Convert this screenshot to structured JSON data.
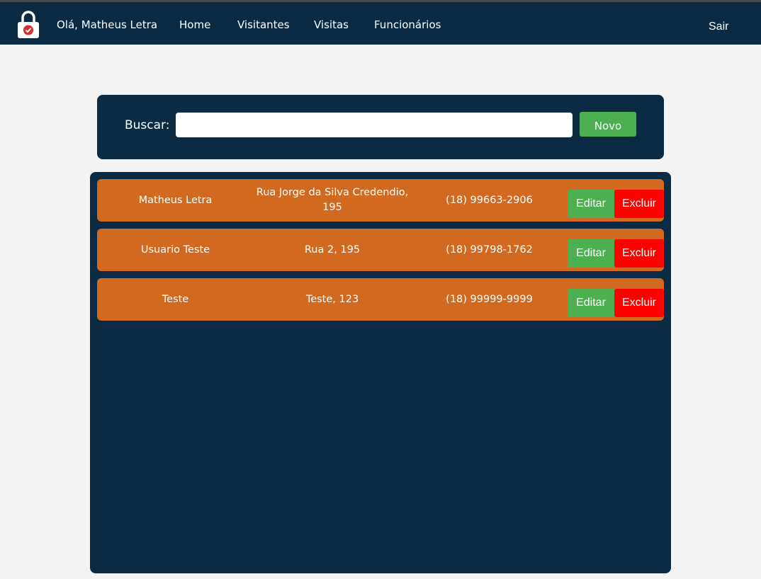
{
  "navbar": {
    "greeting": "Olá, Matheus Letra",
    "links": [
      "Home",
      "Visitantes",
      "Visitas",
      "Funcionários"
    ],
    "logout": "Sair",
    "logo_icon": "padlock-check-icon"
  },
  "search": {
    "label": "Buscar:",
    "value": "",
    "new_button": "Novo"
  },
  "visitors": [
    {
      "name": "Matheus Letra",
      "address": "Rua Jorge da Silva Credendio, 195",
      "phone": "(18) 99663-2906"
    },
    {
      "name": "Usuario Teste",
      "address": "Rua 2, 195",
      "phone": "(18) 99798-1762"
    },
    {
      "name": "Teste",
      "address": "Teste, 123",
      "phone": "(18) 99999-9999"
    }
  ],
  "actions": {
    "edit": "Editar",
    "delete": "Excluir"
  },
  "colors": {
    "navy": "#0b2b45",
    "row_orange": "#d16a20",
    "edit_green": "#4caf50",
    "delete_red": "#ff0000",
    "background": "#f3f3f3"
  }
}
